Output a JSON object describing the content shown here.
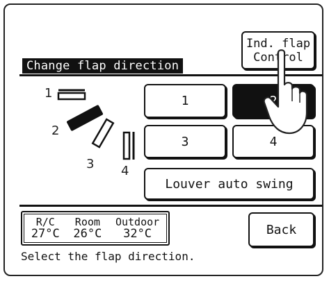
{
  "header": {
    "title": "Change flap direction",
    "ind_flap_line1": "Ind. flap",
    "ind_flap_line2": "Control"
  },
  "flap_diagram": {
    "labels": [
      "1",
      "2",
      "3",
      "4"
    ]
  },
  "buttons": {
    "pos1": "1",
    "pos2": "2",
    "pos3": "3",
    "pos4": "4",
    "swing": "Louver auto swing",
    "back": "Back",
    "selected": "2"
  },
  "temperatures": {
    "rc_label": "R/C",
    "rc_value": "27°C",
    "room_label": "Room",
    "room_value": "26°C",
    "outdoor_label": "Outdoor",
    "outdoor_value": "32°C"
  },
  "status": {
    "message": "Select the flap direction."
  }
}
